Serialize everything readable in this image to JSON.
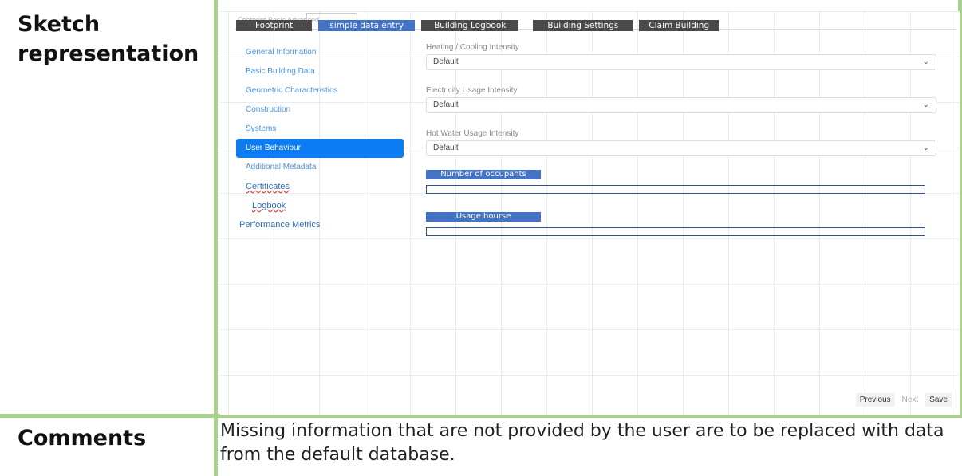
{
  "document": {
    "row1_label": "Sketch representation",
    "row2_label": "Comments",
    "comment_text": "Missing information that are not provided by the user are to be replaced with data from the default database."
  },
  "mockup": {
    "faint_tabs": "Footprint   Basic   Advanced",
    "tabs": [
      "Footprint",
      "simple data entry",
      "Building Logbook",
      "Building Settings",
      "Claim Building"
    ],
    "active_tab_index": 1,
    "nav": [
      "General Information",
      "Basic Building Data",
      "Geometric Characteristics",
      "Construction",
      "Systems",
      "User Behaviour",
      "Additional Metadata",
      "Certificates",
      "Logbook",
      "Performance Metrics"
    ],
    "active_nav_index": 5,
    "fields": {
      "heating_label": "Heating / Cooling Intensity",
      "heating_value": "Default",
      "electricity_label": "Electricity Usage Intensity",
      "electricity_value": "Default",
      "hotwater_label": "Hot Water Usage Intensity",
      "hotwater_value": "Default",
      "occupants_label": "Number of occupants",
      "usage_label": "Usage hourse"
    },
    "footer": {
      "previous": "Previous",
      "next": "Next",
      "save": "Save"
    },
    "colors": {
      "accent": "#4472c4",
      "active_nav": "#0d7cf2",
      "border_green": "#a9d18e"
    }
  }
}
